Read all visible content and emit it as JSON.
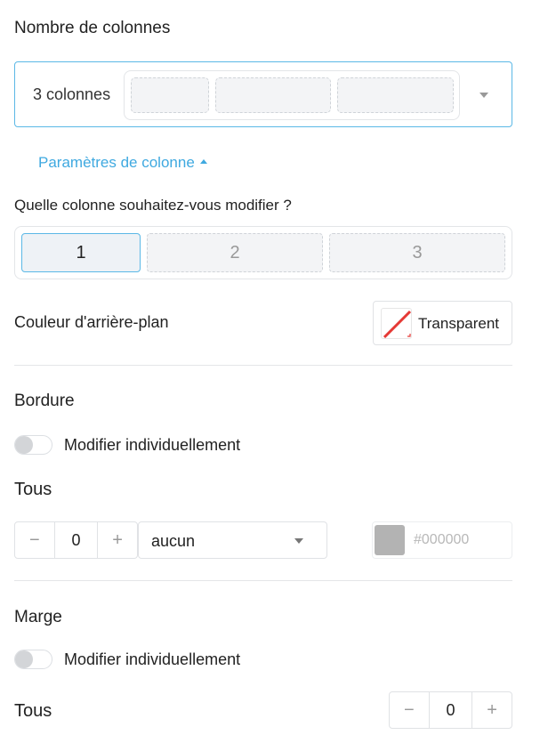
{
  "columns": {
    "heading": "Nombre de colonnes",
    "selected_label": "3 colonnes",
    "settings_link": "Paramètres de colonne",
    "question": "Quelle colonne souhaitez-vous modifier ?",
    "tabs": [
      "1",
      "2",
      "3"
    ],
    "active_tab": "1"
  },
  "background": {
    "label": "Couleur d'arrière-plan",
    "value": "Transparent"
  },
  "border": {
    "heading": "Bordure",
    "toggle_label": "Modifier individuellement",
    "all_label": "Tous",
    "width_value": "0",
    "minus": "−",
    "plus": "+",
    "style_value": "aucun",
    "color_placeholder": "#000000",
    "color_swatch": "#b3b3b3"
  },
  "margin": {
    "heading": "Marge",
    "toggle_label": "Modifier individuellement",
    "all_label": "Tous",
    "value": "0",
    "minus": "−",
    "plus": "+"
  },
  "colors": {
    "accent": "#3fa9e0",
    "border_active": "#5bb8e6"
  }
}
